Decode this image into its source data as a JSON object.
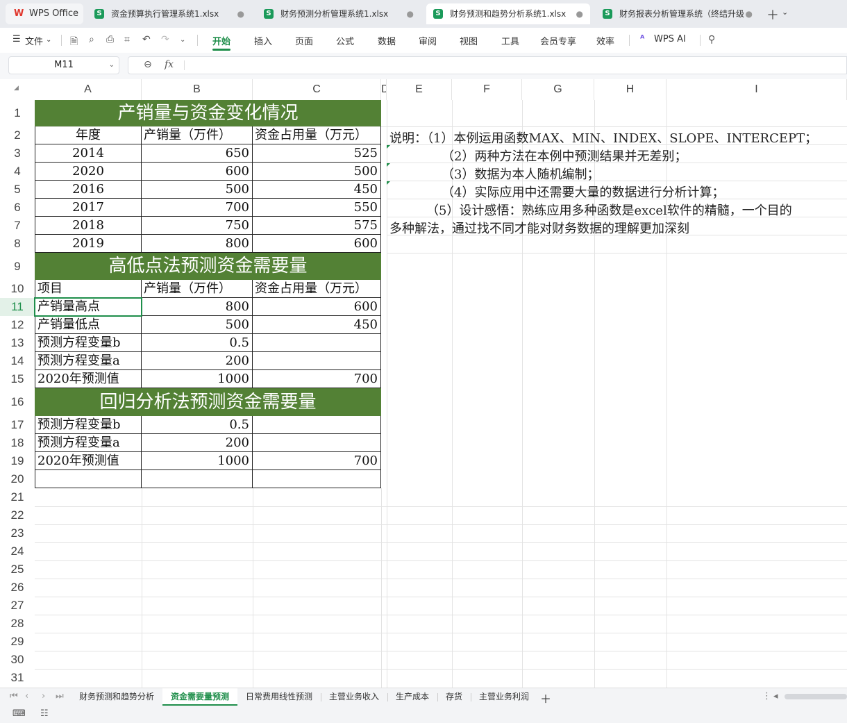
{
  "tabs": {
    "wps": "WPS Office",
    "files": [
      {
        "name": "资金预算执行管理系统1.xlsx",
        "icon": "S"
      },
      {
        "name": "财务预测分析管理系统1.xlsx",
        "icon": "S"
      },
      {
        "name": "财务预测和趋势分析系统1.xlsx",
        "icon": "S"
      },
      {
        "name": "财务报表分析管理系统（终结升级",
        "icon": "S"
      }
    ]
  },
  "ribbon": {
    "file_menu": "文件",
    "items": [
      "开始",
      "插入",
      "页面",
      "公式",
      "数据",
      "审阅",
      "视图",
      "工具",
      "会员专享",
      "效率"
    ],
    "wps_ai": "WPS AI"
  },
  "formula_bar": {
    "cell_ref": "M11",
    "fx": "fx",
    "formula": ""
  },
  "columns": [
    "A",
    "B",
    "C",
    "D",
    "E",
    "F",
    "G",
    "H",
    "I"
  ],
  "rows": [
    "1",
    "2",
    "3",
    "4",
    "5",
    "6",
    "7",
    "8",
    "9",
    "10",
    "11",
    "12",
    "13",
    "14",
    "15",
    "16",
    "17",
    "18",
    "19",
    "20",
    "21",
    "22",
    "23",
    "24",
    "25",
    "26",
    "27",
    "28",
    "29",
    "30",
    "31"
  ],
  "accent_color": "#538135",
  "sheet": {
    "title1": "产销量与资金变化情况",
    "table1_headers": [
      "年度",
      "产销量（万件）",
      "资金占用量（万元）"
    ],
    "table1_rows": [
      [
        "2014",
        "650",
        "525"
      ],
      [
        "2020",
        "600",
        "500"
      ],
      [
        "2016",
        "500",
        "450"
      ],
      [
        "2017",
        "700",
        "550"
      ],
      [
        "2018",
        "750",
        "575"
      ],
      [
        "2019",
        "800",
        "600"
      ]
    ],
    "title2": "高低点法预测资金需要量",
    "table2_headers": [
      "项目",
      "产销量（万件）",
      "资金占用量（万元）"
    ],
    "table2_rows": [
      [
        "产销量高点",
        "800",
        "600"
      ],
      [
        "产销量低点",
        "500",
        "450"
      ],
      [
        "预测方程变量b",
        "0.5",
        ""
      ],
      [
        "预测方程变量a",
        "200",
        ""
      ],
      [
        "2020年预测值",
        "1000",
        "700"
      ]
    ],
    "title3": "回归分析法预测资金需要量",
    "table3_rows": [
      [
        "预测方程变量b",
        "0.5",
        ""
      ],
      [
        "预测方程变量a",
        "200",
        ""
      ],
      [
        "2020年预测值",
        "1000",
        "700"
      ]
    ],
    "notes": [
      "说明：（1）本例运用函数MAX、MIN、INDEX、SLOPE、INTERCEPT；",
      "（2）两种方法在本例中预测结果并无差别；",
      "（3）数据为本人随机编制；",
      "（4）实际应用中还需要大量的数据进行分析计算；",
      "（5）设计感悟：熟练应用多种函数是excel软件的精髓，一个目的",
      "多种解法，通过找不同才能对财务数据的理解更加深刻"
    ]
  },
  "sheet_tabs": [
    "财务预测和趋势分析",
    "资金需要量预测",
    "日常费用线性预测",
    "主营业务收入",
    "生产成本",
    "存货",
    "主营业务利润"
  ],
  "active_sheet": "资金需要量预测"
}
